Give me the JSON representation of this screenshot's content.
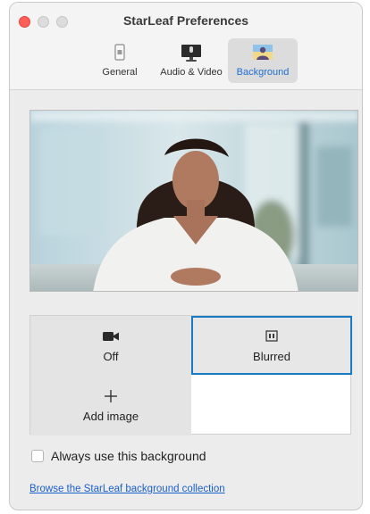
{
  "window": {
    "title": "StarLeaf Preferences"
  },
  "tabs": [
    {
      "label": "General",
      "icon": "phone-icon",
      "active": false
    },
    {
      "label": "Audio & Video",
      "icon": "monitor-mic-icon",
      "active": false
    },
    {
      "label": "Background",
      "icon": "person-background-icon",
      "active": true
    }
  ],
  "background_options": [
    {
      "label": "Off",
      "icon": "video-camera-icon",
      "selected": false
    },
    {
      "label": "Blurred",
      "icon": "blur-icon",
      "selected": true
    },
    {
      "label": "Add image",
      "icon": "plus-icon",
      "selected": false
    }
  ],
  "always_use": {
    "label": "Always use this background",
    "checked": false
  },
  "browse_link": {
    "label": "Browse the StarLeaf background collection"
  },
  "colors": {
    "accent": "#1a7bc4",
    "link": "#1a5fc9",
    "close_button": "#ff5f57"
  }
}
